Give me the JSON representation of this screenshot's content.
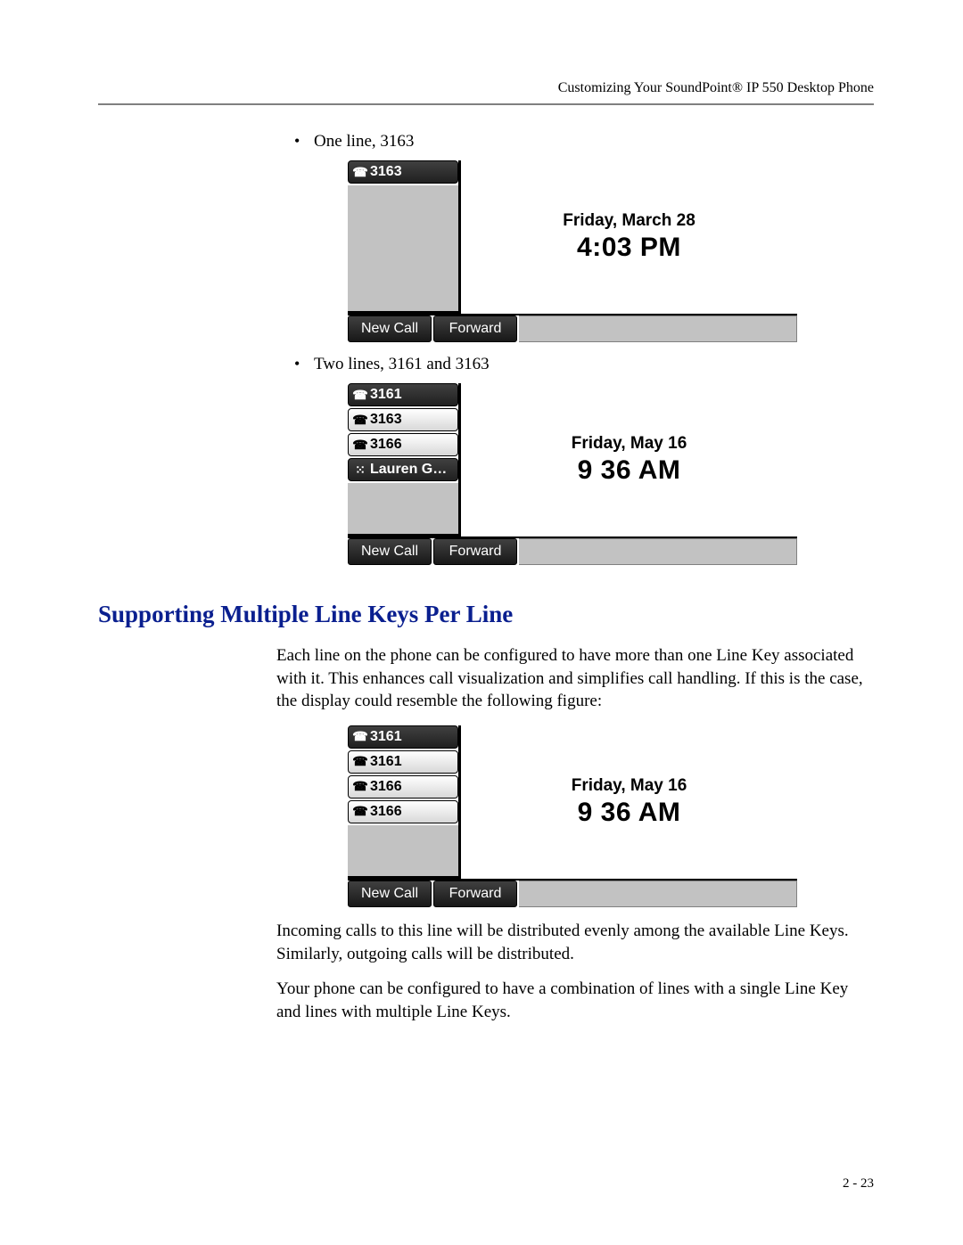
{
  "header": "Customizing Your SoundPoint® IP 550 Desktop Phone",
  "bullets": {
    "one": "One line, 3163",
    "two": "Two lines, 3161 and 3163"
  },
  "fig1": {
    "lines": [
      {
        "label": "3163",
        "style": "dark",
        "icon": "handset"
      }
    ],
    "date": "Friday, March 28",
    "time": "4:03 PM",
    "soft": [
      "New Call",
      "Forward"
    ]
  },
  "fig2": {
    "lines": [
      {
        "label": "3161",
        "style": "dark",
        "icon": "handset"
      },
      {
        "label": "3163",
        "style": "light",
        "icon": "handset"
      },
      {
        "label": "3166",
        "style": "light",
        "icon": "handset"
      },
      {
        "label": "Lauren G…",
        "style": "dark",
        "icon": "grid"
      }
    ],
    "date": "Friday, May 16",
    "time": "9 36 AM",
    "soft": [
      "New Call",
      "Forward"
    ]
  },
  "heading": "Supporting Multiple Line Keys Per Line",
  "para1": "Each line on the phone can be configured to have more than one Line Key associated with it. This enhances call visualization and simplifies call handling. If this is the case, the display could resemble the following figure:",
  "fig3": {
    "lines": [
      {
        "label": "3161",
        "style": "dark",
        "icon": "handset"
      },
      {
        "label": "3161",
        "style": "light",
        "icon": "handset"
      },
      {
        "label": "3166",
        "style": "light",
        "icon": "handset"
      },
      {
        "label": "3166",
        "style": "light",
        "icon": "handset"
      }
    ],
    "date": "Friday, May 16",
    "time": "9 36 AM",
    "soft": [
      "New Call",
      "Forward"
    ]
  },
  "para2": "Incoming calls to this line will be distributed evenly among the available Line Keys. Similarly, outgoing calls will be distributed.",
  "para3": "Your phone can be configured to have a combination of lines with a single Line Key and lines with multiple Line Keys.",
  "pageNumber": "2 - 23"
}
